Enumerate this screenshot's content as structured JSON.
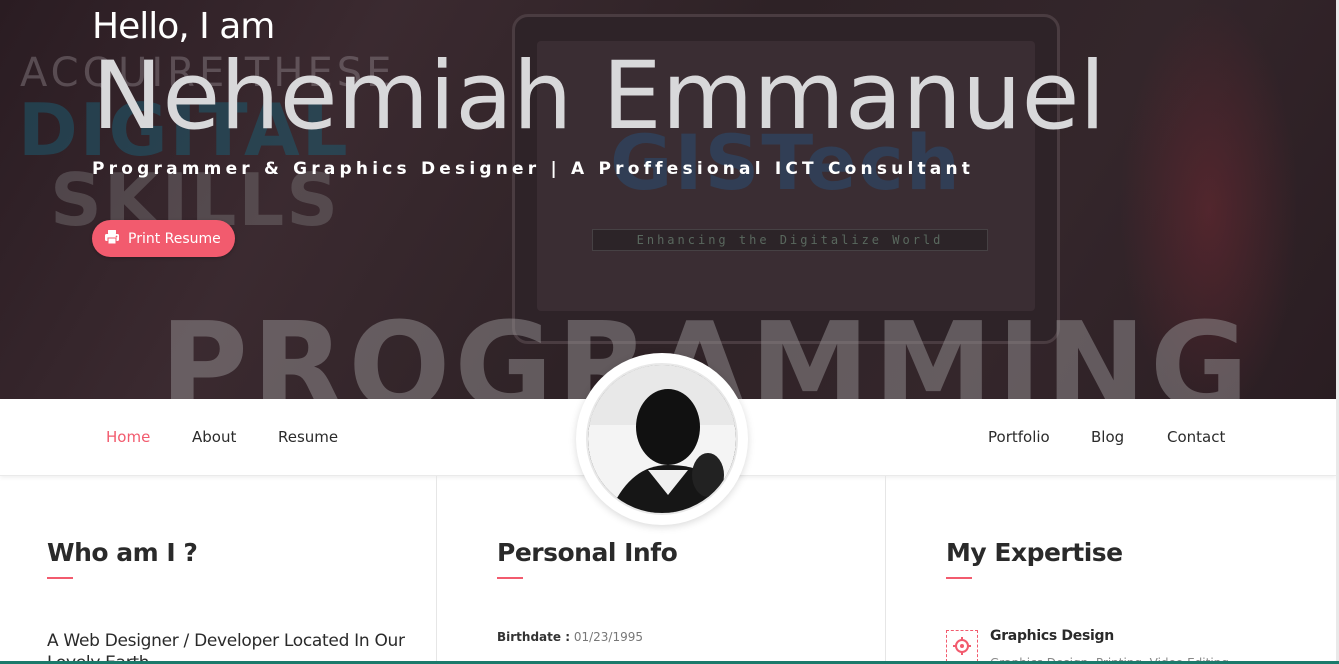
{
  "hero": {
    "greeting": "Hello, I am",
    "name": "Nehemiah Emmanuel",
    "tagline": "Programmer & Graphics Designer | A Proffesional ICT Consultant",
    "print_button": "Print Resume",
    "background_words": {
      "acquire": "ACQUIRE THESE",
      "digital": "DIGITAL",
      "skills": "SKILLS",
      "programming": "PROGRAMMING",
      "logo": "GISTech",
      "logo_tagline": "Enhancing the Digitalize World"
    }
  },
  "nav": {
    "home": "Home",
    "about": "About",
    "resume": "Resume",
    "portfolio": "Portfolio",
    "blog": "Blog",
    "contact": "Contact"
  },
  "who": {
    "title": "Who am I ?",
    "text": "A Web Designer / Developer Located In Our Lovely Earth"
  },
  "personal": {
    "title": "Personal Info",
    "birthdate_label": "Birthdate :",
    "birthdate_value": "01/23/1995"
  },
  "expertise": {
    "title": "My Expertise",
    "items": [
      {
        "title": "Graphics Design",
        "desc": "Graphics Design, Printing, Video Editing"
      }
    ]
  },
  "colors": {
    "accent": "#f25b6e",
    "hero_bg": "#2e2226"
  }
}
